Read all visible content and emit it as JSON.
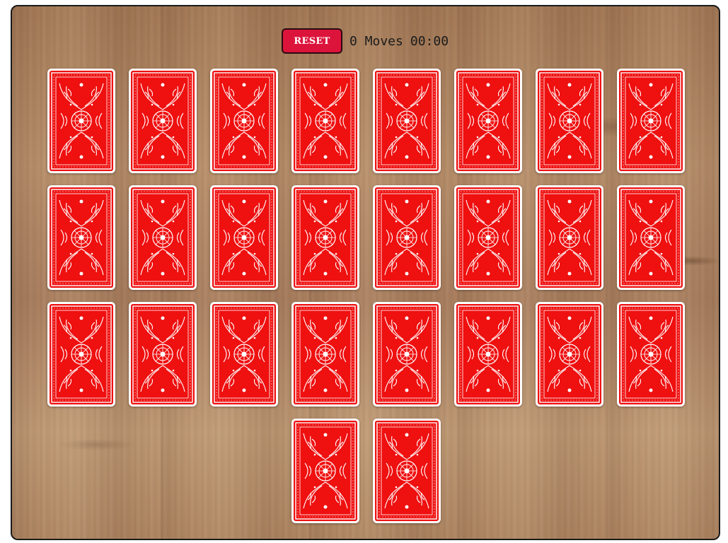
{
  "controls": {
    "reset_label": "RESET",
    "moves": "0 Moves",
    "timer": "00:00"
  },
  "colors": {
    "accent": "#dc143c",
    "card_back": "#ef1010"
  },
  "board": {
    "card_count": 26,
    "face_down": true,
    "card_back_icon": "ornate-card-back-icon"
  }
}
